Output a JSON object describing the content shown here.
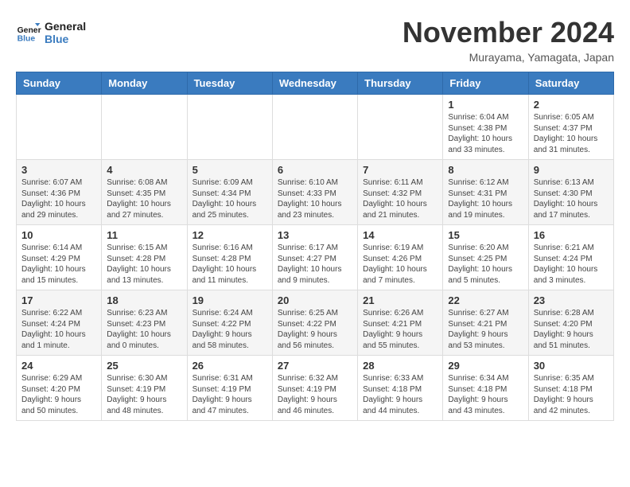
{
  "header": {
    "logo_line1": "General",
    "logo_line2": "Blue",
    "month": "November 2024",
    "location": "Murayama, Yamagata, Japan"
  },
  "days_of_week": [
    "Sunday",
    "Monday",
    "Tuesday",
    "Wednesday",
    "Thursday",
    "Friday",
    "Saturday"
  ],
  "weeks": [
    [
      {
        "day": "",
        "info": ""
      },
      {
        "day": "",
        "info": ""
      },
      {
        "day": "",
        "info": ""
      },
      {
        "day": "",
        "info": ""
      },
      {
        "day": "",
        "info": ""
      },
      {
        "day": "1",
        "info": "Sunrise: 6:04 AM\nSunset: 4:38 PM\nDaylight: 10 hours and 33 minutes."
      },
      {
        "day": "2",
        "info": "Sunrise: 6:05 AM\nSunset: 4:37 PM\nDaylight: 10 hours and 31 minutes."
      }
    ],
    [
      {
        "day": "3",
        "info": "Sunrise: 6:07 AM\nSunset: 4:36 PM\nDaylight: 10 hours and 29 minutes."
      },
      {
        "day": "4",
        "info": "Sunrise: 6:08 AM\nSunset: 4:35 PM\nDaylight: 10 hours and 27 minutes."
      },
      {
        "day": "5",
        "info": "Sunrise: 6:09 AM\nSunset: 4:34 PM\nDaylight: 10 hours and 25 minutes."
      },
      {
        "day": "6",
        "info": "Sunrise: 6:10 AM\nSunset: 4:33 PM\nDaylight: 10 hours and 23 minutes."
      },
      {
        "day": "7",
        "info": "Sunrise: 6:11 AM\nSunset: 4:32 PM\nDaylight: 10 hours and 21 minutes."
      },
      {
        "day": "8",
        "info": "Sunrise: 6:12 AM\nSunset: 4:31 PM\nDaylight: 10 hours and 19 minutes."
      },
      {
        "day": "9",
        "info": "Sunrise: 6:13 AM\nSunset: 4:30 PM\nDaylight: 10 hours and 17 minutes."
      }
    ],
    [
      {
        "day": "10",
        "info": "Sunrise: 6:14 AM\nSunset: 4:29 PM\nDaylight: 10 hours and 15 minutes."
      },
      {
        "day": "11",
        "info": "Sunrise: 6:15 AM\nSunset: 4:28 PM\nDaylight: 10 hours and 13 minutes."
      },
      {
        "day": "12",
        "info": "Sunrise: 6:16 AM\nSunset: 4:28 PM\nDaylight: 10 hours and 11 minutes."
      },
      {
        "day": "13",
        "info": "Sunrise: 6:17 AM\nSunset: 4:27 PM\nDaylight: 10 hours and 9 minutes."
      },
      {
        "day": "14",
        "info": "Sunrise: 6:19 AM\nSunset: 4:26 PM\nDaylight: 10 hours and 7 minutes."
      },
      {
        "day": "15",
        "info": "Sunrise: 6:20 AM\nSunset: 4:25 PM\nDaylight: 10 hours and 5 minutes."
      },
      {
        "day": "16",
        "info": "Sunrise: 6:21 AM\nSunset: 4:24 PM\nDaylight: 10 hours and 3 minutes."
      }
    ],
    [
      {
        "day": "17",
        "info": "Sunrise: 6:22 AM\nSunset: 4:24 PM\nDaylight: 10 hours and 1 minute."
      },
      {
        "day": "18",
        "info": "Sunrise: 6:23 AM\nSunset: 4:23 PM\nDaylight: 10 hours and 0 minutes."
      },
      {
        "day": "19",
        "info": "Sunrise: 6:24 AM\nSunset: 4:22 PM\nDaylight: 9 hours and 58 minutes."
      },
      {
        "day": "20",
        "info": "Sunrise: 6:25 AM\nSunset: 4:22 PM\nDaylight: 9 hours and 56 minutes."
      },
      {
        "day": "21",
        "info": "Sunrise: 6:26 AM\nSunset: 4:21 PM\nDaylight: 9 hours and 55 minutes."
      },
      {
        "day": "22",
        "info": "Sunrise: 6:27 AM\nSunset: 4:21 PM\nDaylight: 9 hours and 53 minutes."
      },
      {
        "day": "23",
        "info": "Sunrise: 6:28 AM\nSunset: 4:20 PM\nDaylight: 9 hours and 51 minutes."
      }
    ],
    [
      {
        "day": "24",
        "info": "Sunrise: 6:29 AM\nSunset: 4:20 PM\nDaylight: 9 hours and 50 minutes."
      },
      {
        "day": "25",
        "info": "Sunrise: 6:30 AM\nSunset: 4:19 PM\nDaylight: 9 hours and 48 minutes."
      },
      {
        "day": "26",
        "info": "Sunrise: 6:31 AM\nSunset: 4:19 PM\nDaylight: 9 hours and 47 minutes."
      },
      {
        "day": "27",
        "info": "Sunrise: 6:32 AM\nSunset: 4:19 PM\nDaylight: 9 hours and 46 minutes."
      },
      {
        "day": "28",
        "info": "Sunrise: 6:33 AM\nSunset: 4:18 PM\nDaylight: 9 hours and 44 minutes."
      },
      {
        "day": "29",
        "info": "Sunrise: 6:34 AM\nSunset: 4:18 PM\nDaylight: 9 hours and 43 minutes."
      },
      {
        "day": "30",
        "info": "Sunrise: 6:35 AM\nSunset: 4:18 PM\nDaylight: 9 hours and 42 minutes."
      }
    ]
  ]
}
